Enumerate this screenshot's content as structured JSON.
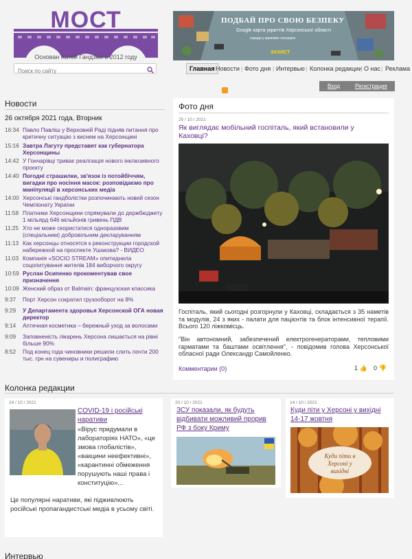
{
  "site": {
    "logo_text": "МОСТ",
    "slogan": "Основан Катей Гандзюк в 2012 году",
    "search_placeholder": "Поиск по сайту"
  },
  "banner": {
    "title": "ПОДБАЙ ПРО СВОЮ БЕЗПЕКУ",
    "subtitle": "Google карта укриттів Херсонської області",
    "small": "поради у кризових ситуаціях",
    "brand": "ЗАХИСТ"
  },
  "nav": {
    "items": [
      "Главная",
      "Новости",
      "Фото дня",
      "Интервью",
      "Колонка редакции",
      "О нас",
      "Реклама"
    ]
  },
  "auth": {
    "login": "Вход",
    "register": "Регистрация"
  },
  "news": {
    "title": "Новости",
    "date": "26 октября 2021 года, Вторник",
    "items": [
      {
        "time": "16:34",
        "text": "Павло Павліш у Верховній Раді підняв питання про критичну ситуацію з киснем на Херсонщині"
      },
      {
        "time": "15:16",
        "text": "Завтра Лагуту представят как губернатора Херсонщины"
      },
      {
        "time": "14:42",
        "text": "У Гончарівці триває реалізація нового інклюзивного проєкту"
      },
      {
        "time": "14:40",
        "text": "Погодні страшилки, зв'язок із потойбіччям, вигадки про носіння масок: розповідаємо про маніпуляції в херсонських медіа"
      },
      {
        "time": "14:00",
        "text": "Херсонські гандболістки розпочинають новий сезон Чемпіонату України"
      },
      {
        "time": "11:58",
        "text": "Платники Херсонщини спрямували до держбюджету 1 мільярд 646 мільйонів гривень ПДВ"
      },
      {
        "time": "11:25",
        "text": "Хто не може скористатися одноразовим (спеціальним) добровільним декларуванням"
      },
      {
        "time": "11:13",
        "text": "Как херсонцы относятся к реконструкции городской набережной на проспекте Ушакова? - ВИДЕО"
      },
      {
        "time": "11:03",
        "text": "Компанія «SOCIO STREAM» опитиднила соцопитування жителів 184 виборчого округу"
      },
      {
        "time": "10:59",
        "text": "Руслан Осипенко прокоментував свое призначення"
      },
      {
        "time": "10:09",
        "text": "Женский образ от Balmain: французская классика"
      },
      {
        "time": "9:37",
        "text": "Порт Херсон сократил грузооборот на 8%"
      },
      {
        "time": "9:29",
        "text": "У Департамента здоровья Херсонской ОГА новая директор"
      },
      {
        "time": "9:14",
        "text": "Аптечная косметика – бережный уход за волосами"
      },
      {
        "time": "9:09",
        "text": "Заповненість лікарень Херсона лишається на рівні більше 90%"
      },
      {
        "time": "8:52",
        "text": "Под конец года чиновники решили слить почти 200 тыс. грн на сувениры и полиграфию"
      }
    ]
  },
  "photo": {
    "title": "Фото дня",
    "date": "25 / 10 / 2021",
    "headline": "Як виглядає мобільний госпіталь, який встановили у Каховці?",
    "text1": "Госпіталь, який сьогодні розгорнули у Каховці, складається з 35 наметів та модулів, 24 з яких - палати для пацієнтів та блок інтенсивної терапії. Всього 120 ліжкомісць.",
    "text2": "\"Він автономний, забезпечений електрогенераторами, тепловими гарматами та баштами освітлення\", - повідомив голова Херсонської обласної ради Олександр Самойленко.",
    "comments": "Комментарии (0)",
    "likes": "1",
    "dislikes": "0"
  },
  "editorial": {
    "title": "Колонка редакции",
    "cards": [
      {
        "date": "24 / 10 / 2021",
        "headline": "COVID-19 і російські наративи",
        "quote": "«Вірус придумали в лабораторіях НАТО», «це змова глобалістів», «вакцини неефективні», «карантинні обмеження порушують наші права і конституцію»...",
        "desc": "Це популярні наративи, які підживлюють російські пропагандистські медіа в усьому світі."
      },
      {
        "date": "20 / 10 / 2021",
        "headline": "ЗСУ показали, як будуть відбивати можливий прорив РФ з боку Криму"
      },
      {
        "date": "14 / 10 / 2021",
        "headline": "Куди піти у Херсоні у вихідні 14-17 жовтня",
        "image_text": "Куди піти в Херсоні у вихідні"
      }
    ]
  },
  "interview": {
    "title": "Интервью"
  },
  "colors": {
    "accent": "#5b2c83",
    "logo": "#7b4aa3",
    "background": "#f3f3f3"
  }
}
